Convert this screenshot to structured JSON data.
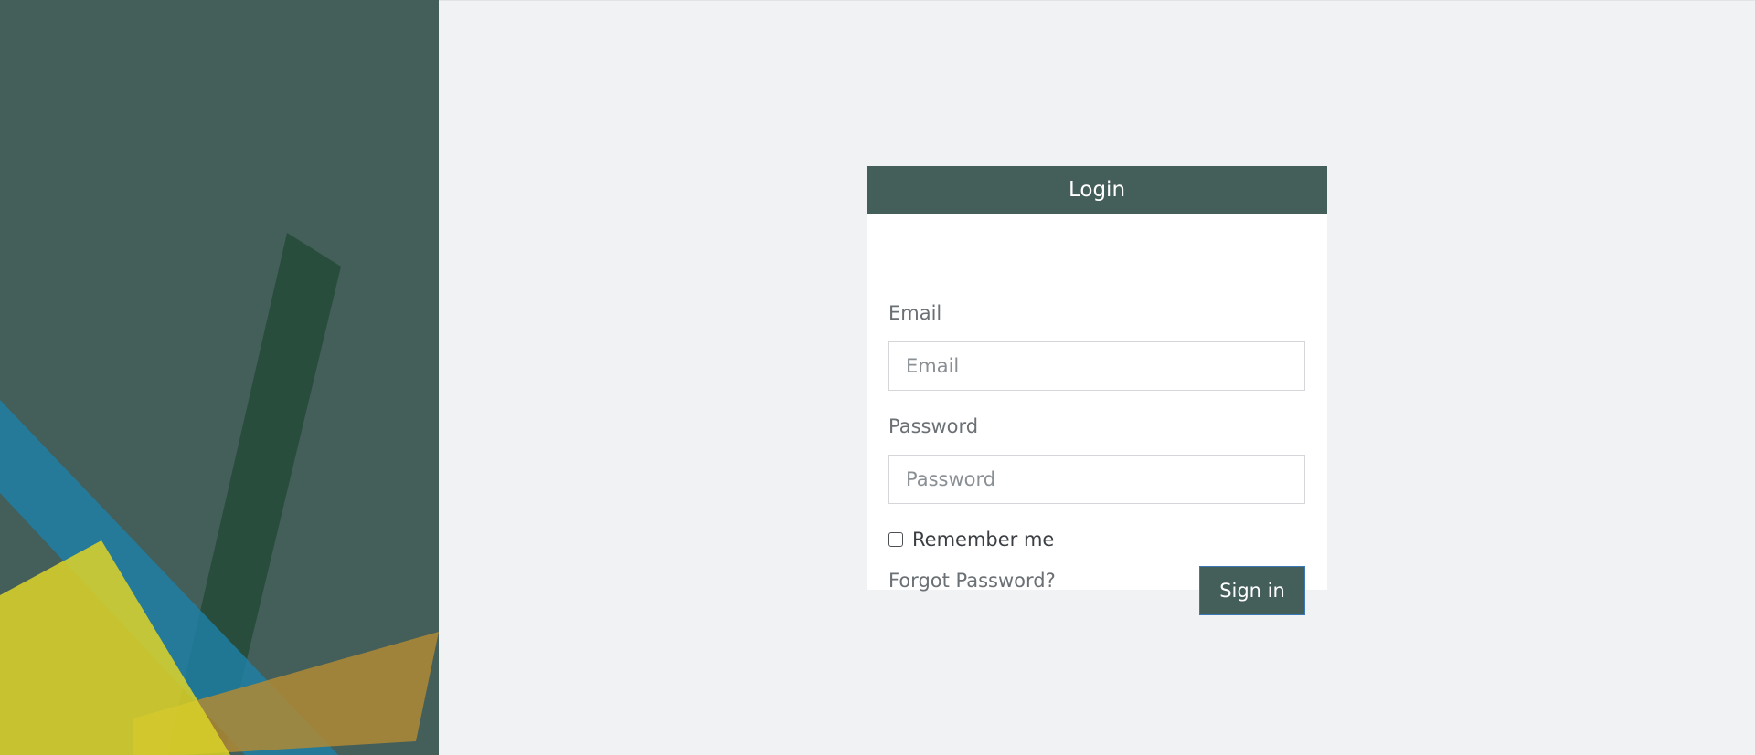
{
  "colors": {
    "brand": "#445e5a",
    "page_background": "#f1f2f4",
    "card_background": "#ffffff",
    "accent_blue": "#1f7fa3",
    "accent_yellow": "#d4cc2e",
    "accent_orange": "#a88135",
    "accent_dark_green": "#264b38"
  },
  "login": {
    "title": "Login",
    "email_label": "Email",
    "email_placeholder": "Email",
    "email_value": "",
    "password_label": "Password",
    "password_placeholder": "Password",
    "password_value": "",
    "remember_label": "Remember me",
    "remember_checked": false,
    "forgot_link": "Forgot Password?",
    "signin_button": "Sign in"
  }
}
